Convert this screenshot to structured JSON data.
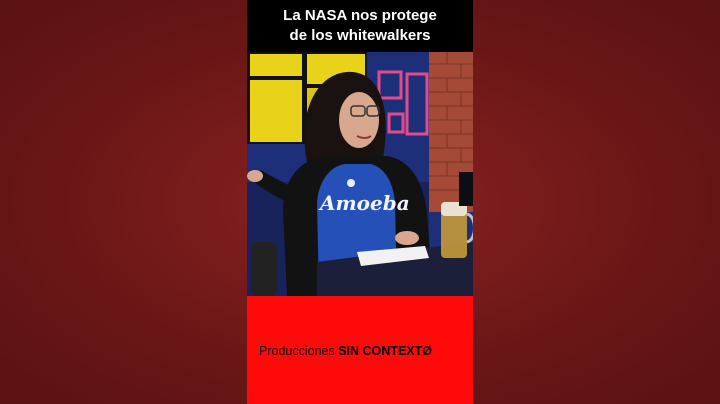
{
  "caption": {
    "line1": "La NASA nos protege",
    "line2": "de los whitewalkers"
  },
  "brand": {
    "prefix": "Producciones ",
    "highlight": "SIN CONTEXT",
    "suffix": "Ø"
  },
  "shirt_text": "Amoeba",
  "colors": {
    "outer_background": "#7a1c1c",
    "bottom_bar": "#ff0a0a",
    "caption_background": "#000000"
  }
}
